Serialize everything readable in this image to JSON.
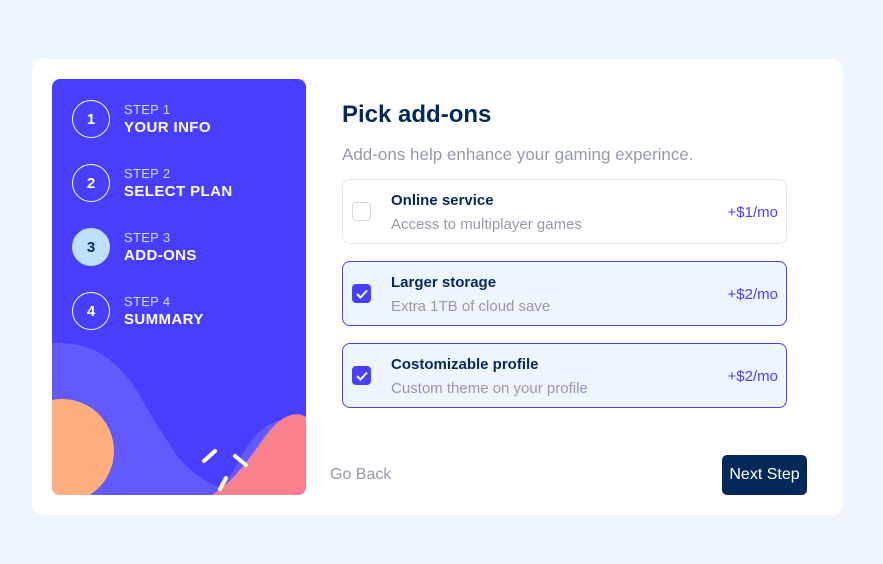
{
  "sidebar": {
    "steps": [
      {
        "number": "1",
        "label": "STEP 1",
        "title": "YOUR INFO",
        "active": false
      },
      {
        "number": "2",
        "label": "STEP 2",
        "title": "SELECT PLAN",
        "active": false
      },
      {
        "number": "3",
        "label": "STEP 3",
        "title": "ADD-ONS",
        "active": true
      },
      {
        "number": "4",
        "label": "STEP 4",
        "title": "SUMMARY",
        "active": false
      }
    ]
  },
  "main": {
    "title": "Pick add-ons",
    "subtitle": "Add-ons help enhance your gaming experince.",
    "addons": [
      {
        "name": "Online service",
        "description": "Access to multiplayer games",
        "price": "+$1/mo",
        "checked": false
      },
      {
        "name": "Larger storage",
        "description": "Extra 1TB of cloud save",
        "price": "+$2/mo",
        "checked": true
      },
      {
        "name": "Costomizable profile",
        "description": "Custom theme on your profile",
        "price": "+$2/mo",
        "checked": true
      }
    ],
    "back_label": "Go Back",
    "next_label": "Next Step"
  },
  "colors": {
    "sidebar_bg": "#483eff",
    "accent": "#483eff",
    "navy": "#02295a",
    "selected_bg": "#eff5ff",
    "muted": "#9699ab",
    "orange": "#ffaf7e",
    "pink": "#f9818e",
    "light_blue": "#6259ff"
  }
}
